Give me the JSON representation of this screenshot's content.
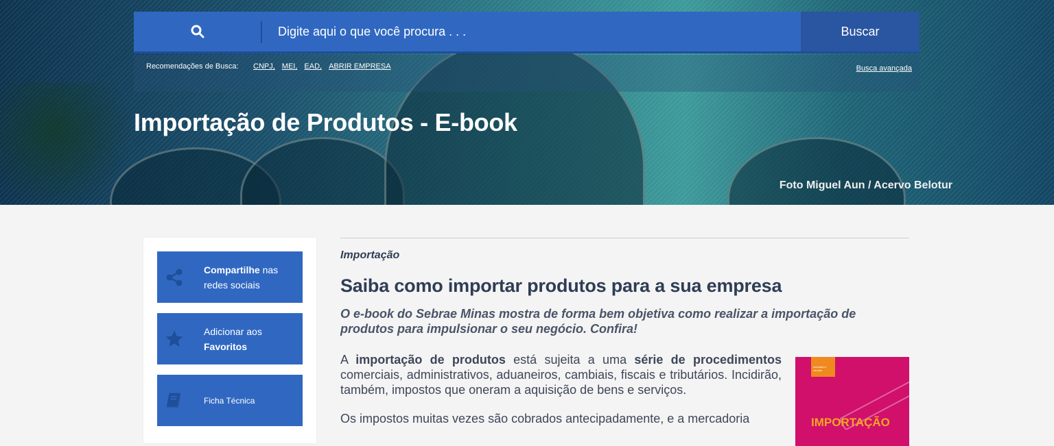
{
  "search": {
    "placeholder": "Digite aqui o que você procura . . .",
    "button_label": "Buscar",
    "recommendations_label": "Recomendações de Busca:",
    "recommendations": [
      "CNPJ,",
      "MEI,",
      "EAD,",
      "ABRIR EMPRESA"
    ],
    "advanced_link": "Busca avançada"
  },
  "hero": {
    "title": "Importação de Produtos - E-book",
    "photo_credit": "Foto Miguel Aun / Acervo Belotur"
  },
  "sidebar": {
    "share": {
      "bold": "Compartilhe",
      "rest1": " nas",
      "rest2": "redes sociais",
      "icon": "share-icon"
    },
    "favorites": {
      "line1": "Adicionar aos",
      "bold": "Favoritos",
      "icon": "star-icon"
    },
    "datasheet": {
      "label": "Ficha Técnica",
      "icon": "book-icon"
    }
  },
  "article": {
    "category": "Importação",
    "headline": "Saiba como importar produtos para a sua empresa",
    "lead": "O e-book do Sebrae Minas mostra de forma bem objetiva como realizar a importação de produtos para impulsionar o seu negócio. Confira!",
    "p1": {
      "a": "A ",
      "b1": "importação de produtos",
      "c": " está sujeita a uma ",
      "b2": "série de procedimentos",
      "d": " comerciais, administrativos, aduaneiros, cambiais, fiscais e tributários. Incidirão, também,  impostos que oneram a aquisição de bens e serviços."
    },
    "p2": "Os impostos muitas vezes são cobrados antecipadamente, e a mercadoria"
  },
  "ebook_cover": {
    "tag": "mercado e vendas",
    "title": "IMPORTAÇÃO"
  },
  "colors": {
    "primary_blue": "#3068c1",
    "dark_blue": "#2a55a0",
    "text_navy": "#2f3d55",
    "cover_magenta": "#d0106a",
    "cover_orange": "#f08a1f"
  }
}
